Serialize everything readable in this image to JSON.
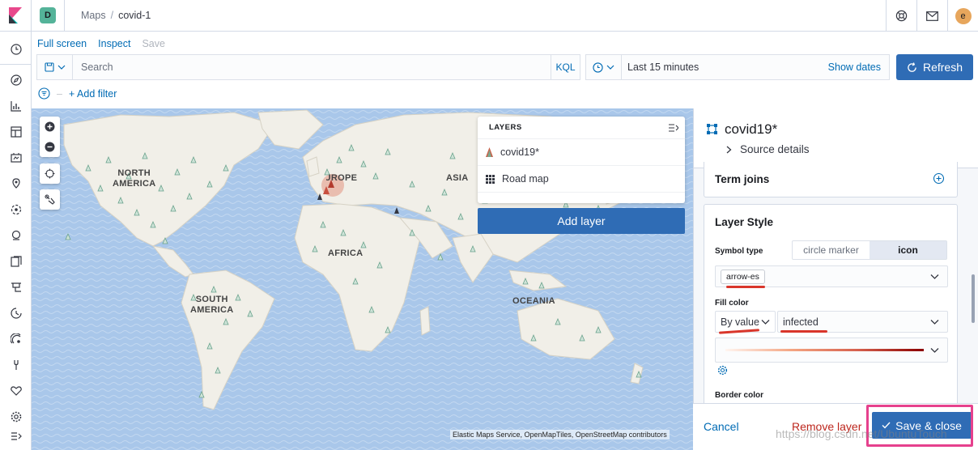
{
  "header": {
    "space_initial": "D",
    "breadcrumbs": [
      "Maps",
      "covid-1"
    ],
    "user_initial": "e"
  },
  "topmenu": {
    "full_screen": "Full screen",
    "inspect": "Inspect",
    "save": "Save"
  },
  "query": {
    "placeholder": "Search",
    "language": "KQL"
  },
  "time": {
    "range": "Last 15 minutes",
    "show_dates": "Show dates",
    "refresh": "Refresh"
  },
  "filters": {
    "add_filter": "+ Add filter"
  },
  "map": {
    "continent_labels": [
      {
        "text": "NORTH\nAMERICA"
      },
      {
        "text": "SOUTH\nAMERICA"
      },
      {
        "text": "EUROPE"
      },
      {
        "text": "AFRICA"
      },
      {
        "text": "ASIA"
      },
      {
        "text": "OCEANIA"
      }
    ],
    "attribution": "Elastic Maps Service, OpenMapTiles, OpenStreetMap contributors"
  },
  "layers_panel": {
    "title": "LAYERS",
    "layers": [
      {
        "name": "covid19*",
        "icon": "marker-layer-icon"
      },
      {
        "name": "Road map",
        "icon": "tile-grid-icon"
      }
    ],
    "add_layer": "Add layer"
  },
  "editor": {
    "layer_name": "covid19*",
    "source_details": "Source details",
    "term_joins": "Term joins",
    "layer_style": "Layer Style",
    "symbol_type_label": "Symbol type",
    "symbol_options": [
      "circle marker",
      "icon"
    ],
    "symbol_selected": "icon",
    "icon_value": "arrow-es",
    "fill_color_label": "Fill color",
    "fill_mode": "By value",
    "fill_field": "infected",
    "border_color_label": "Border color",
    "cancel": "Cancel",
    "remove_layer": "Remove layer",
    "save_close": "Save & close"
  },
  "watermark": "https://blog.csdn.net/UbuntuTouch",
  "colors": {
    "primary": "#2f6cb5",
    "link": "#006bb4",
    "danger": "#bd271e",
    "highlight": "#e6418d",
    "annotation_red": "#d9362b",
    "water": "#a9c7ea",
    "land": "#f1efe8"
  }
}
